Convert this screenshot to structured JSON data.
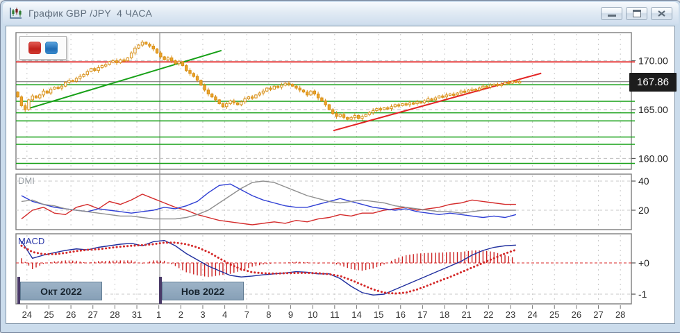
{
  "window": {
    "title": "График GBP /JPY  4 ЧАСА"
  },
  "panes": {
    "dmi_label": "DMI",
    "macd_label": "MACD"
  },
  "months": [
    {
      "label": "Окт 2022"
    },
    {
      "label": "Нов 2022"
    }
  ],
  "toolbar": {
    "red_button_color": "#c9302c",
    "blue_button_color": "#2a7fc1"
  },
  "colors": {
    "candle": "#ECA42B",
    "candle_edge": "#D89018",
    "green_level": "#17A017",
    "red_level": "#E32424",
    "dmi_blue": "#2F3FD4",
    "dmi_red": "#D42A2A",
    "dmi_gray": "#8F8F8F",
    "macd_line": "#1F2E9E",
    "macd_signal": "#D42A2A",
    "macd_hist": "#CC2222",
    "month_separator": "#4A3A68",
    "price_tag_bg": "#1C1C1C"
  },
  "chart_data": [
    {
      "type": "candlestick",
      "title": "GBP/JPY 4-hour candles",
      "x_dates": [
        "24",
        "25",
        "26",
        "27",
        "28",
        "31",
        "1",
        "2",
        "3",
        "4",
        "7",
        "8",
        "9",
        "10",
        "11",
        "14",
        "15",
        "16",
        "17",
        "18",
        "21",
        "22",
        "23",
        "24",
        "25",
        "26",
        "27",
        "28"
      ],
      "bars_per_day": 6,
      "open_first": 166.8,
      "closes": [
        166.3,
        165.4,
        165.0,
        166.0,
        166.4,
        166.2,
        166.5,
        166.9,
        166.7,
        167.1,
        167.3,
        167.2,
        167.4,
        167.8,
        168.0,
        167.9,
        168.2,
        168.4,
        168.6,
        168.9,
        169.2,
        169.0,
        169.3,
        169.5,
        169.6,
        169.9,
        170.0,
        169.8,
        170.1,
        170.0,
        170.3,
        170.8,
        171.3,
        171.6,
        171.9,
        171.7,
        171.5,
        171.2,
        170.8,
        170.4,
        170.1,
        170.3,
        170.0,
        169.7,
        169.9,
        169.5,
        169.0,
        168.7,
        168.4,
        168.0,
        167.5,
        167.0,
        166.6,
        166.3,
        166.0,
        165.6,
        165.3,
        165.6,
        165.9,
        165.7,
        165.5,
        165.8,
        166.1,
        166.3,
        166.2,
        166.5,
        166.7,
        166.9,
        167.2,
        167.1,
        167.4,
        167.3,
        167.5,
        167.7,
        167.6,
        167.4,
        167.2,
        167.0,
        166.8,
        166.5,
        166.9,
        166.6,
        166.2,
        165.9,
        165.5,
        165.0,
        164.6,
        164.3,
        164.5,
        164.2,
        164.0,
        164.2,
        164.4,
        164.1,
        164.3,
        164.5,
        164.7,
        164.9,
        165.1,
        165.0,
        165.2,
        165.1,
        165.3,
        165.5,
        165.4,
        165.6,
        165.5,
        165.7,
        165.6,
        165.8,
        165.7,
        165.9,
        166.1,
        166.0,
        166.2,
        166.4,
        166.3,
        166.5,
        166.6,
        166.5,
        166.7,
        166.9,
        166.8,
        167.0,
        167.1,
        167.0,
        167.2,
        167.4,
        167.3,
        167.5,
        167.6,
        167.5,
        167.6,
        167.8,
        167.7,
        167.9,
        167.86,
        167.86
      ],
      "ylim": [
        158.9,
        172.9
      ],
      "y_ticks": [
        {
          "v": 170,
          "label": "170.00"
        },
        {
          "v": 165,
          "label": "165.00"
        },
        {
          "v": 160,
          "label": "160.00"
        }
      ],
      "levels": {
        "current": 167.86,
        "current_label": "167.86",
        "red": 169.88,
        "green": [
          167.55,
          165.85,
          164.67,
          163.85,
          162.2,
          161.45,
          159.5
        ],
        "grid_dashed": [
          170,
          165,
          160
        ]
      },
      "trendlines": [
        {
          "color": "#17A017",
          "d1": 0.05,
          "p1": 165.1,
          "d2": 8.85,
          "p2": 171.05
        },
        {
          "color": "#E32424",
          "d1": 13.94,
          "p1": 162.85,
          "d2": 23.4,
          "p2": 168.72
        }
      ],
      "month_boundary_day": 6
    },
    {
      "type": "line",
      "name": "DMI",
      "points_per_day": 2,
      "ylim": [
        6.7,
        44.8
      ],
      "y_ticks": [
        {
          "v": 40,
          "label": "40"
        },
        {
          "v": 20,
          "label": "20"
        }
      ],
      "grid_dashed": [
        40,
        20
      ],
      "series": [
        {
          "name": "red",
          "color": "#D42A2A",
          "values": [
            14,
            20,
            22,
            18,
            17,
            22,
            24,
            21,
            26,
            24,
            27,
            31,
            28,
            25,
            22,
            20,
            17,
            15,
            13,
            12,
            11,
            10,
            11,
            12,
            11,
            13,
            12,
            14,
            15,
            17,
            16,
            18,
            18,
            20,
            21,
            22,
            20,
            21,
            22,
            24,
            25,
            27,
            26,
            25,
            24,
            24
          ]
        },
        {
          "name": "blue",
          "color": "#2F3FD4",
          "values": [
            30,
            26,
            24,
            22,
            21,
            20,
            19,
            21,
            20,
            19,
            18,
            19,
            20,
            22,
            21,
            23,
            26,
            32,
            37,
            38,
            34,
            30,
            27,
            25,
            23,
            22,
            22,
            24,
            26,
            28,
            26,
            24,
            22,
            21,
            20,
            21,
            19,
            18,
            17,
            18,
            17,
            16,
            15,
            16,
            15,
            17
          ]
        },
        {
          "name": "gray",
          "color": "#8F8F8F",
          "values": [
            26,
            27,
            24,
            23,
            21,
            20,
            19,
            18,
            17,
            16,
            16,
            15,
            14,
            14,
            14,
            15,
            17,
            20,
            25,
            30,
            35,
            39,
            40,
            39,
            36,
            33,
            30,
            28,
            26,
            25,
            26,
            27,
            26,
            25,
            23,
            22,
            21,
            20,
            19,
            19,
            18,
            19,
            20,
            20,
            20,
            20
          ]
        }
      ]
    },
    {
      "type": "macd",
      "name": "MACD",
      "points_per_day": 2,
      "ylim": [
        -1.31,
        0.93
      ],
      "y_ticks": [
        {
          "v": 0,
          "label": "+0"
        },
        {
          "v": -1,
          "label": "-1"
        }
      ],
      "zero_line_dashed_red": 0,
      "grid_dashed": [
        -1
      ],
      "macd": [
        0.7,
        0.15,
        0.25,
        0.33,
        0.4,
        0.45,
        0.42,
        0.5,
        0.55,
        0.6,
        0.63,
        0.55,
        0.68,
        0.72,
        0.55,
        0.3,
        0.1,
        -0.1,
        -0.25,
        -0.4,
        -0.45,
        -0.42,
        -0.38,
        -0.35,
        -0.32,
        -0.28,
        -0.3,
        -0.35,
        -0.35,
        -0.5,
        -0.75,
        -0.95,
        -1.03,
        -1.0,
        -0.85,
        -0.7,
        -0.55,
        -0.4,
        -0.25,
        -0.1,
        0.05,
        0.25,
        0.4,
        0.5,
        0.55,
        0.57
      ],
      "signal": [
        0.55,
        0.35,
        0.28,
        0.28,
        0.32,
        0.38,
        0.42,
        0.44,
        0.48,
        0.52,
        0.55,
        0.57,
        0.6,
        0.65,
        0.65,
        0.6,
        0.5,
        0.35,
        0.15,
        -0.05,
        -0.2,
        -0.3,
        -0.33,
        -0.34,
        -0.33,
        -0.32,
        -0.32,
        -0.33,
        -0.36,
        -0.42,
        -0.55,
        -0.7,
        -0.85,
        -0.95,
        -0.98,
        -0.95,
        -0.85,
        -0.72,
        -0.58,
        -0.45,
        -0.3,
        -0.15,
        0.0,
        0.15,
        0.3,
        0.42
      ],
      "histogram": "macd_minus_signal"
    }
  ]
}
